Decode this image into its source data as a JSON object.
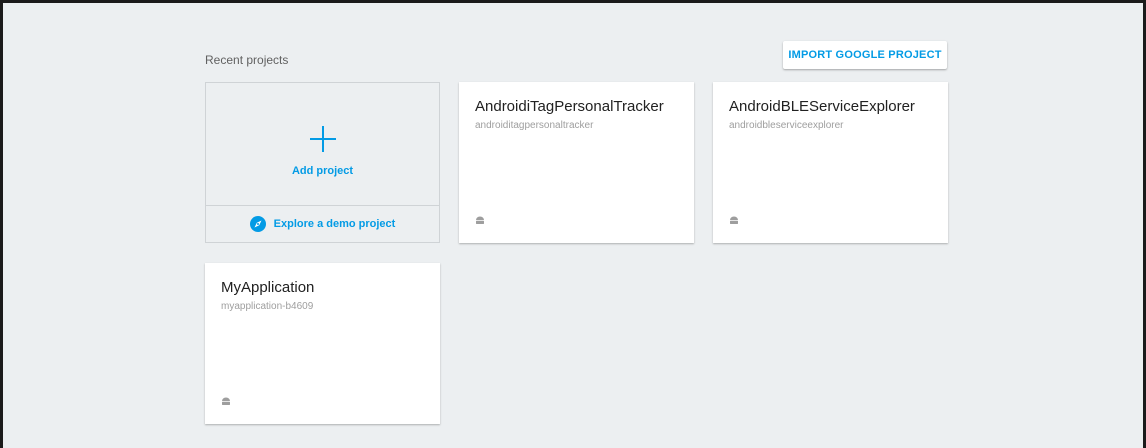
{
  "section": {
    "title": "Recent projects"
  },
  "toolbar": {
    "import_label": "IMPORT GOOGLE PROJECT"
  },
  "add_card": {
    "add_label": "Add project",
    "demo_label": "Explore a demo project",
    "icons": {
      "add": "plus-icon",
      "demo": "compass-icon"
    }
  },
  "projects": [
    {
      "name": "AndroidiTagPersonalTracker",
      "id": "androiditagpersonaltracker",
      "platform_icon": "android-icon"
    },
    {
      "name": "AndroidBLEServiceExplorer",
      "id": "androidbleserviceexplorer",
      "platform_icon": "android-icon"
    },
    {
      "name": "MyApplication",
      "id": "myapplication-b4609",
      "platform_icon": "android-icon"
    }
  ],
  "colors": {
    "accent": "#039be5",
    "background": "#eceff1",
    "card": "#ffffff",
    "title_text": "#212121",
    "secondary_text": "#9e9e9e"
  }
}
